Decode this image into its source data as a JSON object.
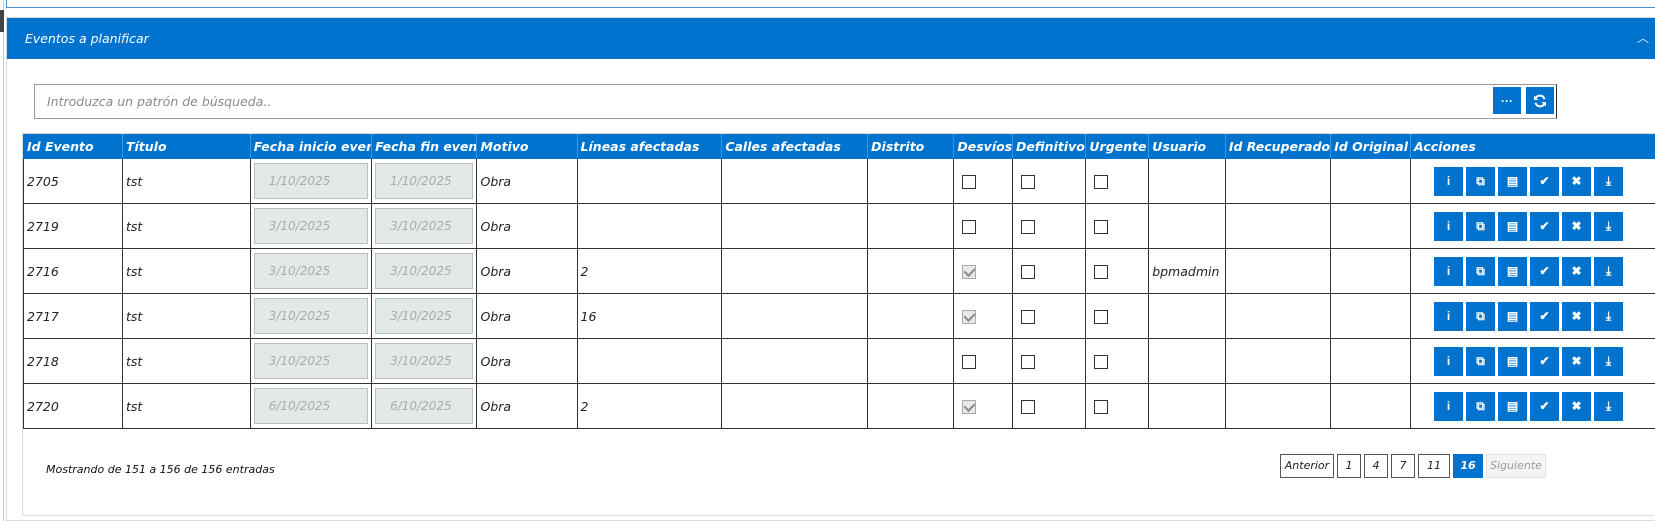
{
  "panel": {
    "title": "Eventos a planificar",
    "collapse_icon": "chevron-up-icon"
  },
  "search": {
    "placeholder": "Introduzca un patrón de búsqueda..",
    "value": ""
  },
  "toolbar": {
    "options_icon": "ellipsis-icon",
    "refresh_icon": "refresh-icon"
  },
  "table": {
    "headers": [
      "Id Evento",
      "Título",
      "Fecha inicio evento",
      "Fecha fin evento",
      "Motivo",
      "Líneas afectadas",
      "Calles afectadas",
      "Distrito",
      "Desvíos",
      "Definitivo",
      "Urgente",
      "Usuario",
      "Id Recuperado",
      "Id Original",
      "Acciones"
    ],
    "rows": [
      {
        "id": "2705",
        "titulo": "tst",
        "inicio": "1/10/2025",
        "fin": "1/10/2025",
        "motivo": "Obra",
        "lineas": "",
        "calles": "",
        "distrito": "",
        "desvios": false,
        "definitivo": false,
        "urgente": false,
        "usuario": "",
        "id_recuperado": "",
        "id_original": ""
      },
      {
        "id": "2719",
        "titulo": "tst",
        "inicio": "3/10/2025",
        "fin": "3/10/2025",
        "motivo": "Obra",
        "lineas": "",
        "calles": "",
        "distrito": "",
        "desvios": false,
        "definitivo": false,
        "urgente": false,
        "usuario": "",
        "id_recuperado": "",
        "id_original": ""
      },
      {
        "id": "2716",
        "titulo": "tst",
        "inicio": "3/10/2025",
        "fin": "3/10/2025",
        "motivo": "Obra",
        "lineas": "2",
        "calles": "",
        "distrito": "",
        "desvios": true,
        "definitivo": false,
        "urgente": false,
        "usuario": "bpmadmin",
        "id_recuperado": "",
        "id_original": ""
      },
      {
        "id": "2717",
        "titulo": "tst",
        "inicio": "3/10/2025",
        "fin": "3/10/2025",
        "motivo": "Obra",
        "lineas": "16",
        "calles": "",
        "distrito": "",
        "desvios": true,
        "definitivo": false,
        "urgente": false,
        "usuario": "",
        "id_recuperado": "",
        "id_original": ""
      },
      {
        "id": "2718",
        "titulo": "tst",
        "inicio": "3/10/2025",
        "fin": "3/10/2025",
        "motivo": "Obra",
        "lineas": "",
        "calles": "",
        "distrito": "",
        "desvios": false,
        "definitivo": false,
        "urgente": false,
        "usuario": "",
        "id_recuperado": "",
        "id_original": ""
      },
      {
        "id": "2720",
        "titulo": "tst",
        "inicio": "6/10/2025",
        "fin": "6/10/2025",
        "motivo": "Obra",
        "lineas": "2",
        "calles": "",
        "distrito": "",
        "desvios": true,
        "definitivo": false,
        "urgente": false,
        "usuario": "",
        "id_recuperado": "",
        "id_original": ""
      }
    ],
    "row_actions": [
      {
        "icon": "info-icon",
        "glyph": "i"
      },
      {
        "icon": "copy-icon",
        "glyph": "⧉"
      },
      {
        "icon": "book-icon",
        "glyph": "▤"
      },
      {
        "icon": "check-icon",
        "glyph": "✔"
      },
      {
        "icon": "close-icon",
        "glyph": "✖"
      },
      {
        "icon": "download-icon",
        "glyph": "⤓"
      }
    ]
  },
  "footer": {
    "info": "Mostrando de 151 a 156 de 156 entradas",
    "pagination": {
      "previous": "Anterior",
      "pages": [
        "1",
        "4",
        "7",
        "11",
        "16"
      ],
      "current": "16",
      "next": "Siguiente"
    }
  },
  "colors": {
    "accent": "#0073cf",
    "readonly_input": "#e3e9e9"
  }
}
